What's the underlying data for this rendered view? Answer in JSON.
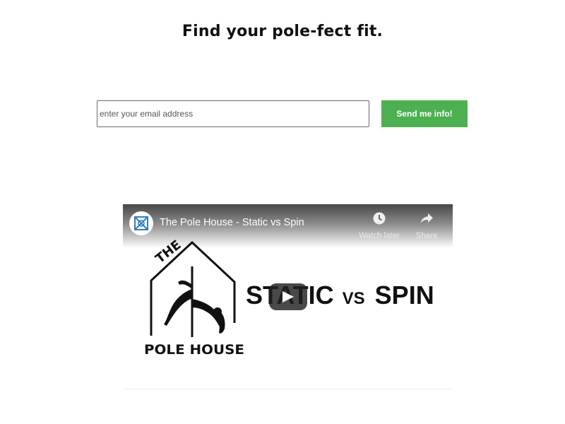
{
  "headline": "Find your pole-fect fit.",
  "signup": {
    "email_placeholder": "enter your email address",
    "email_value": "",
    "send_label": "Send me info!",
    "button_color": "#4caf50"
  },
  "video": {
    "title": "The Pole House - Static vs Spin",
    "watch_later_label": "Watch later",
    "share_label": "Share",
    "thumbnail": {
      "logo_top": "THE",
      "logo_bottom": "POLE HOUSE",
      "word_static": "STATIC",
      "word_vs": "VS",
      "word_spin": "SPIN"
    },
    "icons": {
      "channel": "channel-logo-icon",
      "watch_later": "clock-icon",
      "share": "share-arrow-icon",
      "play": "play-icon"
    }
  }
}
